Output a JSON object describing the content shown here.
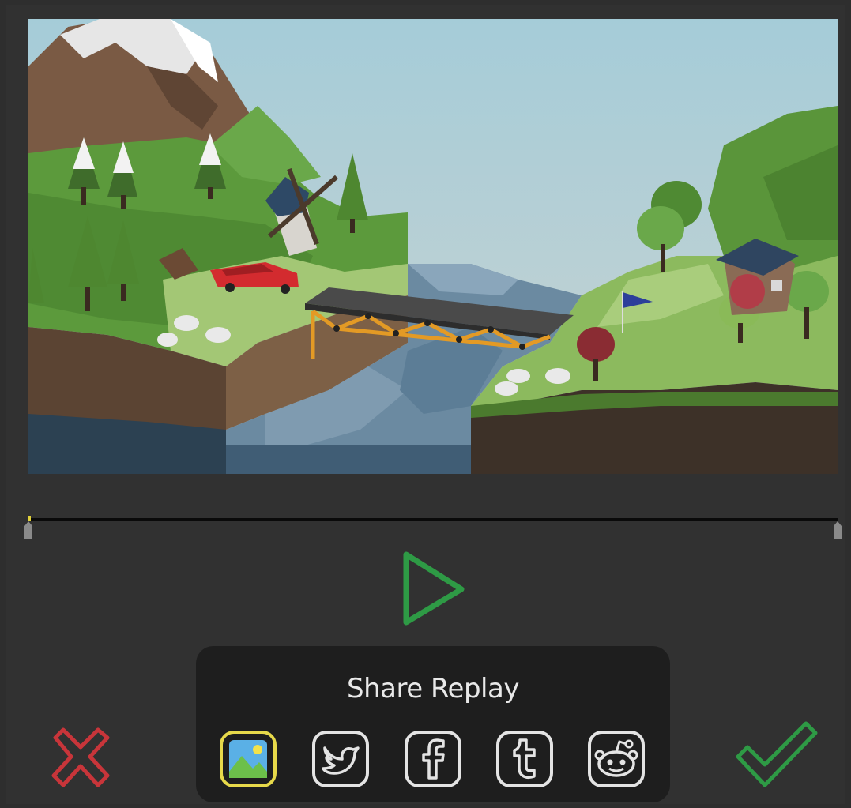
{
  "replay": {
    "title": "Share Replay",
    "progress": 0.0
  },
  "controls": {
    "play_icon": "play-icon",
    "cancel_icon": "close-x-icon",
    "confirm_icon": "checkmark-icon"
  },
  "share_targets": [
    {
      "name": "image",
      "icon": "image-icon",
      "selected": true
    },
    {
      "name": "twitter",
      "icon": "twitter-icon",
      "selected": false
    },
    {
      "name": "facebook",
      "icon": "facebook-icon",
      "selected": false
    },
    {
      "name": "tumblr",
      "icon": "tumblr-icon",
      "selected": false
    },
    {
      "name": "reddit",
      "icon": "reddit-icon",
      "selected": false
    }
  ],
  "colors": {
    "play": "#2e9a45",
    "cancel": "#c8353a",
    "confirm": "#2e9a45",
    "selected_outline": "#e7d94a",
    "icon_outline": "#e4e4e4",
    "panel": "#1e1e1e",
    "background": "#313131"
  }
}
